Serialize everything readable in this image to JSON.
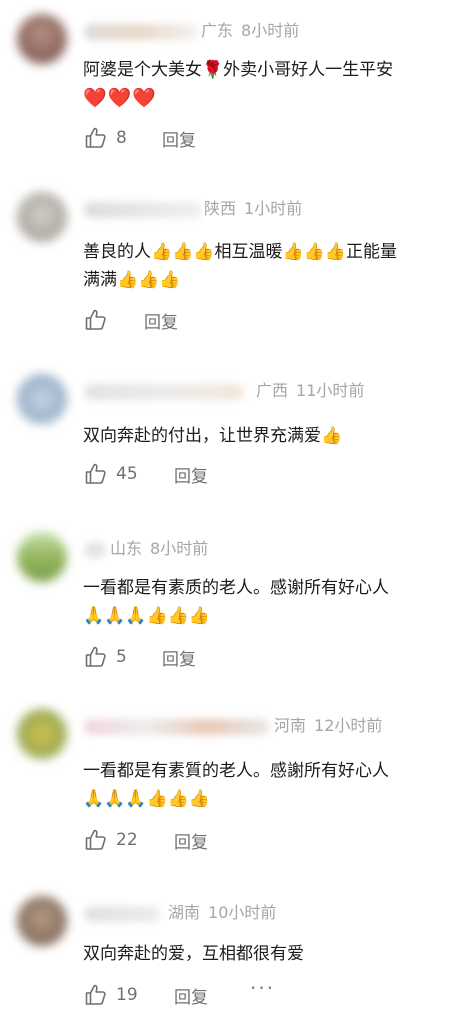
{
  "comments": [
    {
      "location": "广东",
      "time": "8小时前",
      "line1": "阿婆是个大美女🌹外卖小哥好人一生平安",
      "line2": "❤️❤️❤️",
      "likes": "8",
      "reply": "回复",
      "avatar_color": "#8e6a60"
    },
    {
      "location": "陕西",
      "time": "1小时前",
      "line1": "善良的人👍👍👍相互温暖👍👍👍正能量",
      "line2": "满满👍👍👍",
      "likes": "",
      "reply": "回复",
      "avatar_color": "#b8b4ad"
    },
    {
      "location": "广西",
      "time": "11小时前",
      "line1": "双向奔赴的付出，让世界充满爱👍",
      "likes": "45",
      "reply": "回复",
      "avatar_color": "#9fb6cf"
    },
    {
      "location": "山东",
      "time": "8小时前",
      "line1": "一看都是有素质的老人。感谢所有好心人",
      "line2": "🙏🙏🙏👍👍👍",
      "likes": "5",
      "reply": "回复",
      "avatar_color": "#9bb56e"
    },
    {
      "location": "河南",
      "time": "12小时前",
      "line1": "一看都是有素質的老人。感謝所有好心人",
      "line2": "🙏🙏🙏👍👍👍",
      "likes": "22",
      "reply": "回复",
      "avatar_color": "#8fa86a"
    },
    {
      "location": "湖南",
      "time": "10小时前",
      "line1": "双向奔赴的爱，互相都很有爱",
      "likes": "19",
      "reply": "回复",
      "more": "···",
      "avatar_color": "#8a7466"
    }
  ]
}
